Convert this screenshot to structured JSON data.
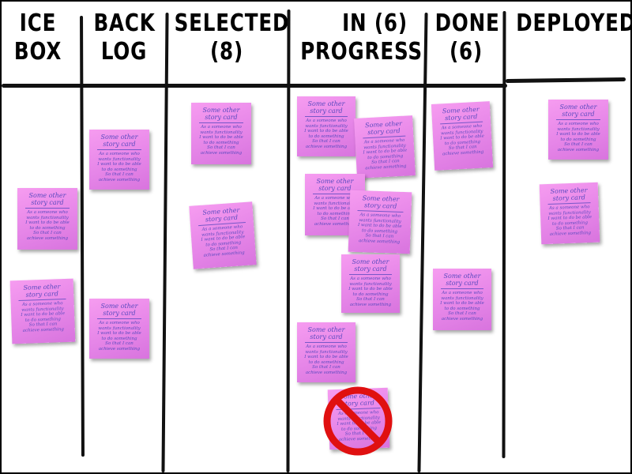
{
  "columns": [
    {
      "line1": "ICE",
      "line2": "BOX"
    },
    {
      "line1": "BACK",
      "line2": "LOG"
    },
    {
      "line1": "SELECTED",
      "line2": "(8)"
    },
    {
      "line1": "IN (6)",
      "line2": "PROGRESS"
    },
    {
      "line1": "DONE",
      "line2": "(6)"
    },
    {
      "line1": "DEPLOYED",
      "line2": ""
    }
  ],
  "card": {
    "title": "Some other\nstory card",
    "body": "As a someone who\nwants functionality\nI want to do be able\nto do something\nSo that I can\nachieve something"
  },
  "blocked_symbol": "no-entry-icon",
  "colors": {
    "card": "#f08ef0",
    "card_text": "#5a4abf",
    "ink": "#111111",
    "blocked": "#e01010"
  }
}
